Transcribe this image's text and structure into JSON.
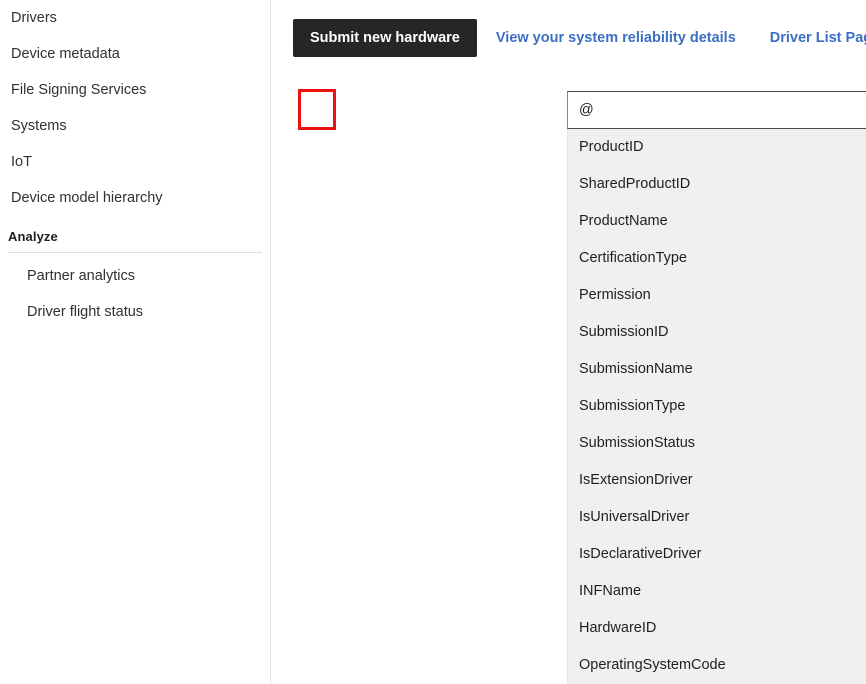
{
  "sidebar": {
    "items": [
      {
        "label": "Drivers",
        "level": 0
      },
      {
        "label": "Device metadata",
        "level": 0
      },
      {
        "label": "File Signing Services",
        "level": 0
      },
      {
        "label": "Systems",
        "level": 0
      },
      {
        "label": "IoT",
        "level": 0
      },
      {
        "label": "Device model hierarchy",
        "level": 0
      }
    ],
    "section": {
      "header": "Analyze",
      "items": [
        {
          "label": "Partner analytics",
          "level": 1
        },
        {
          "label": "Driver flight status",
          "level": 1
        }
      ]
    }
  },
  "tabbar": {
    "primary_label": "Submit new hardware",
    "link1_label": "View your system reliability details",
    "link2_label": "Driver List Page (all)"
  },
  "search": {
    "value": "@",
    "placeholder": ""
  },
  "dropdown": {
    "options": [
      "ProductID",
      "SharedProductID",
      "ProductName",
      "CertificationType",
      "Permission",
      "SubmissionID",
      "SubmissionName",
      "SubmissionType",
      "SubmissionStatus",
      "IsExtensionDriver",
      "IsUniversalDriver",
      "IsDeclarativeDriver",
      "INFName",
      "HardwareID",
      "OperatingSystemCode"
    ]
  },
  "annotation": {
    "color": "#ee1111",
    "target": "search-input-at-symbol"
  },
  "colors": {
    "primary_button_bg": "#262626",
    "link": "#3b6fc4",
    "dropdown_bg": "#f1f0ef",
    "text": "#201f1e",
    "annotation_red": "#ee1111"
  }
}
